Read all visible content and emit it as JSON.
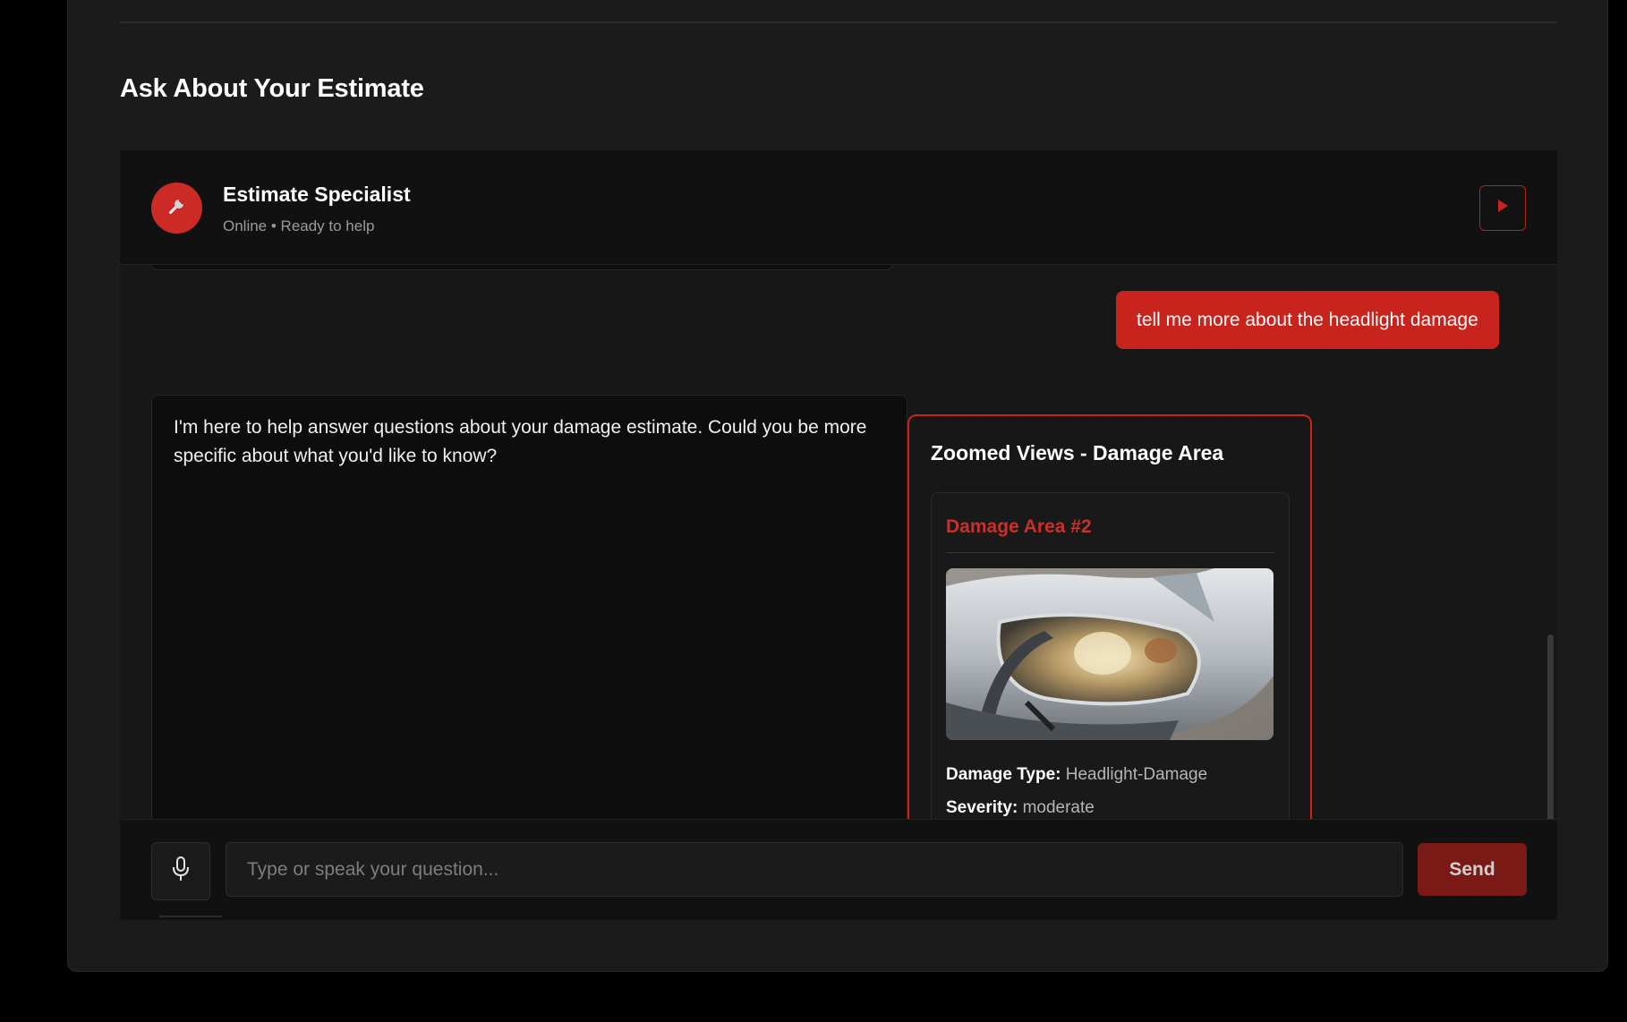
{
  "section": {
    "title": "Ask About Your Estimate"
  },
  "chat_header": {
    "agent_name": "Estimate Specialist",
    "status": "Online • Ready to help",
    "avatar_icon": "wrench-icon",
    "action_icon": "play-icon"
  },
  "messages": {
    "user": "tell me more about the headlight damage",
    "bot": "I'm here to help answer questions about your damage estimate. Could you be more specific about what you'd like to know?"
  },
  "zoom_card": {
    "title": "Zoomed Views - Damage Area",
    "area": {
      "title": "Damage Area #2",
      "damage_type_label": "Damage Type:",
      "damage_type_value": "Headlight-Damage",
      "severity_label": "Severity:",
      "severity_value": "moderate"
    }
  },
  "input_bar": {
    "mic_icon": "microphone-icon",
    "placeholder": "Type or speak your question...",
    "value": "",
    "send_label": "Send"
  },
  "colors": {
    "accent": "#c8231d",
    "background": "#1b1b1b",
    "surface": "#111111",
    "send_disabled": "#7a1a17"
  }
}
